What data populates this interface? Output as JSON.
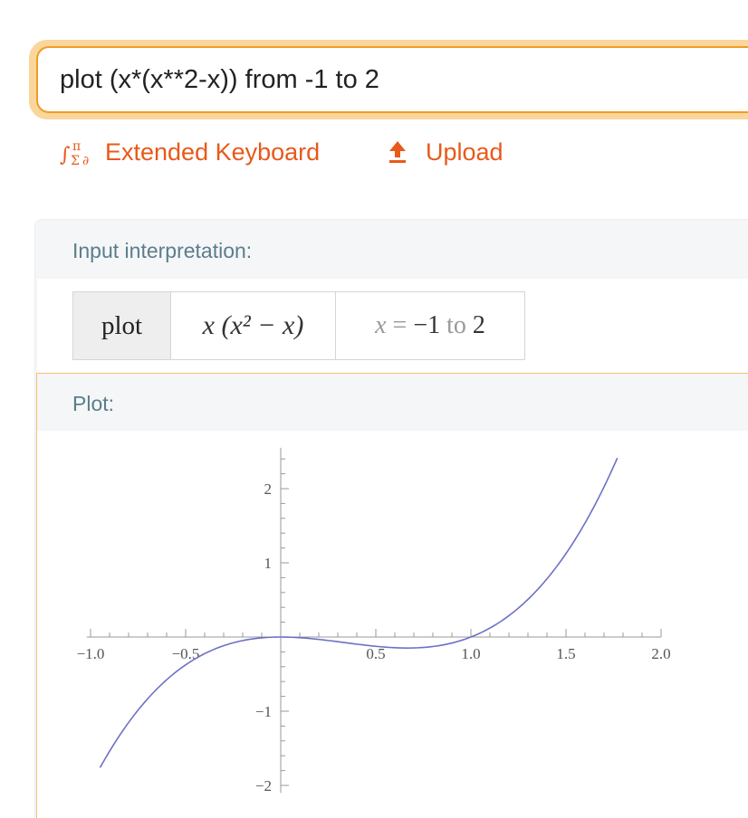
{
  "search": {
    "query": "plot (x*(x**2-x)) from -1 to 2"
  },
  "links": {
    "keyboard_label": "Extended Keyboard",
    "upload_label": "Upload"
  },
  "pods": {
    "interpretation": {
      "title": "Input interpretation:",
      "plot_word": "plot",
      "expression": "x (x² − x)",
      "range_var": "x",
      "range_eq": " = ",
      "range_from": "−1",
      "range_to_word": " to ",
      "range_to": "2"
    },
    "plot": {
      "title": "Plot:"
    }
  },
  "colors": {
    "accent": "#e8591a",
    "focus": "#f29b24",
    "curve": "#6d71c4",
    "pod_title": "#5b7d8c"
  },
  "chart_data": {
    "type": "line",
    "title": "",
    "xlabel": "",
    "ylabel": "",
    "function": "x*(x^2 - x)",
    "xlim": [
      -1.0,
      2.0
    ],
    "ylim": [
      -2.0,
      2.4
    ],
    "x_ticks": [
      "-1.0",
      "-0.5",
      "0.5",
      "1.0",
      "1.5",
      "2.0"
    ],
    "y_ticks": [
      "2",
      "1",
      "-1",
      "-2"
    ],
    "series": [
      {
        "x": [
          -0.95,
          -0.9,
          -0.8,
          -0.7,
          -0.6,
          -0.5,
          -0.4,
          -0.3,
          -0.2,
          -0.1,
          0.0,
          0.1,
          0.2,
          0.3,
          0.4,
          0.5,
          0.6,
          0.667,
          0.7,
          0.8,
          0.9,
          1.0,
          1.1,
          1.2,
          1.3,
          1.4,
          1.5,
          1.6,
          1.7,
          1.77
        ],
        "y": [
          -1.76,
          -1.54,
          -1.15,
          -0.83,
          -0.58,
          -0.38,
          -0.22,
          -0.12,
          -0.05,
          -0.01,
          0.0,
          -0.01,
          -0.03,
          -0.06,
          -0.1,
          -0.13,
          -0.14,
          -0.15,
          -0.15,
          -0.13,
          -0.08,
          0.0,
          0.12,
          0.29,
          0.51,
          0.78,
          1.13,
          1.54,
          2.02,
          2.41
        ]
      }
    ]
  }
}
